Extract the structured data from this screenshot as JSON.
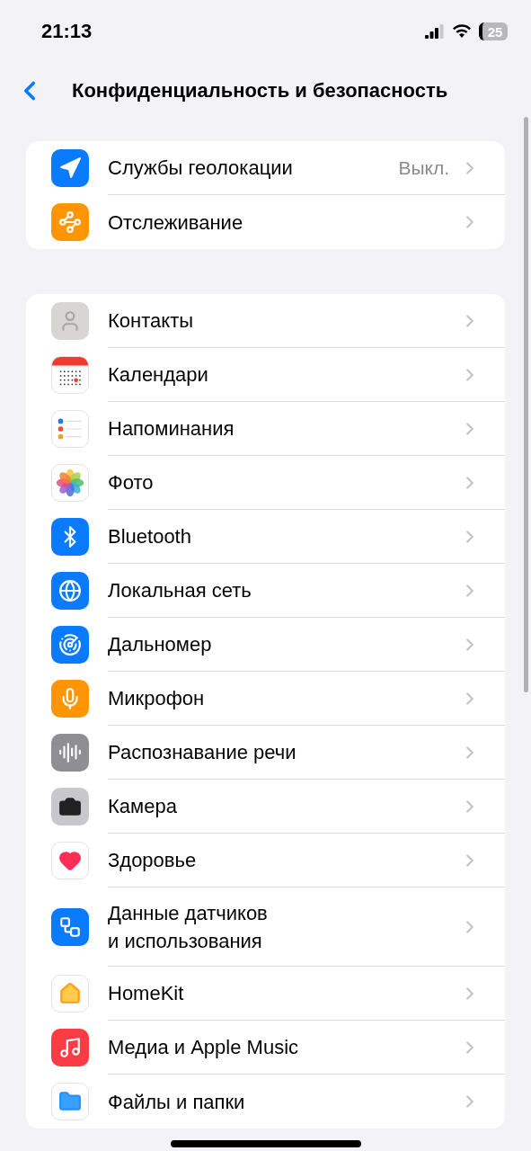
{
  "status_bar": {
    "time": "21:13",
    "battery": "25"
  },
  "nav": {
    "title": "Конфиденциальность и безопасность"
  },
  "groups": [
    {
      "rows": [
        {
          "kind": "location",
          "label": "Службы геолокации",
          "value": "Выкл."
        },
        {
          "kind": "tracking",
          "label": "Отслеживание"
        }
      ]
    },
    {
      "rows": [
        {
          "kind": "contacts",
          "label": "Контакты"
        },
        {
          "kind": "calendar",
          "label": "Календари"
        },
        {
          "kind": "reminders",
          "label": "Напоминания"
        },
        {
          "kind": "photos",
          "label": "Фото"
        },
        {
          "kind": "bluetooth",
          "label": "Bluetooth"
        },
        {
          "kind": "network",
          "label": "Локальная сеть"
        },
        {
          "kind": "ranging",
          "label": "Дальномер"
        },
        {
          "kind": "microphone",
          "label": "Микрофон"
        },
        {
          "kind": "speech",
          "label": "Распознавание речи"
        },
        {
          "kind": "camera",
          "label": "Камера"
        },
        {
          "kind": "health",
          "label": "Здоровье"
        },
        {
          "kind": "sensor",
          "label": "Данные датчиков\nи использования"
        },
        {
          "kind": "homekit",
          "label": "HomeKit"
        },
        {
          "kind": "music",
          "label": "Медиа и Apple Music"
        },
        {
          "kind": "files",
          "label": "Файлы и папки"
        }
      ]
    }
  ]
}
